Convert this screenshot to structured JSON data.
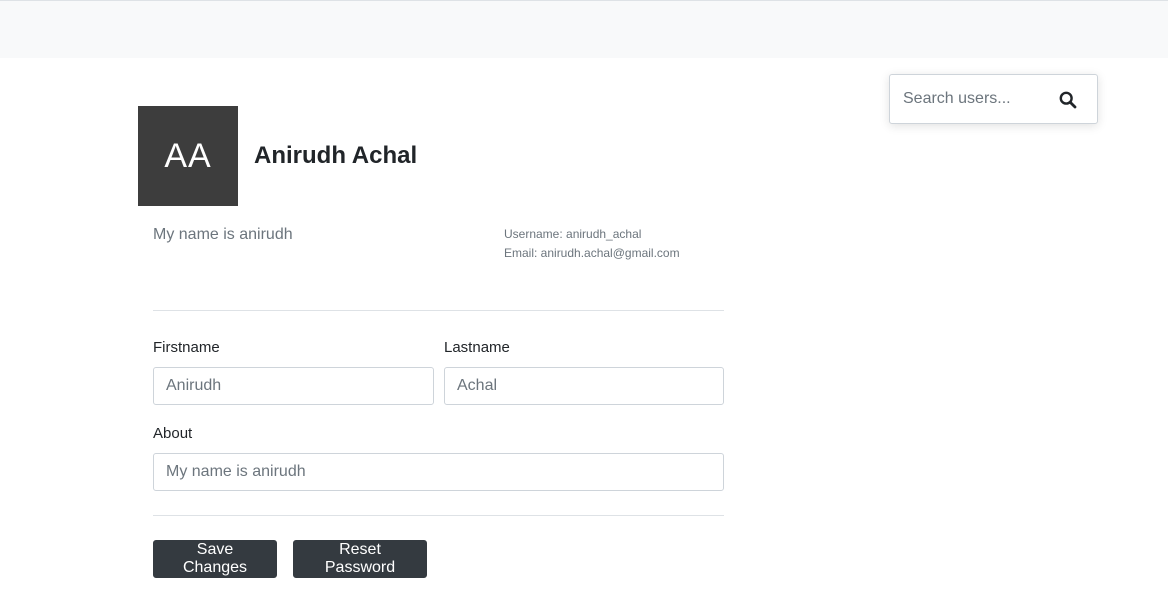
{
  "search": {
    "placeholder": "Search users...",
    "icon": "search-icon"
  },
  "profile": {
    "initials": "AA",
    "full_name": "Anirudh Achal",
    "bio": "My name is anirudh",
    "username_line": "Username: anirudh_achal",
    "email_line": "Email: anirudh.achal@gmail.com"
  },
  "form": {
    "firstname_label": "Firstname",
    "firstname_placeholder": "Anirudh",
    "lastname_label": "Lastname",
    "lastname_placeholder": "Achal",
    "about_label": "About",
    "about_placeholder": "My name is anirudh"
  },
  "actions": {
    "save_label": "Save Changes",
    "reset_label": "Reset Password"
  },
  "colors": {
    "avatar_bg": "#3d3d3d",
    "button_bg": "#343a40",
    "topbar_bg": "#f8f9fa"
  }
}
